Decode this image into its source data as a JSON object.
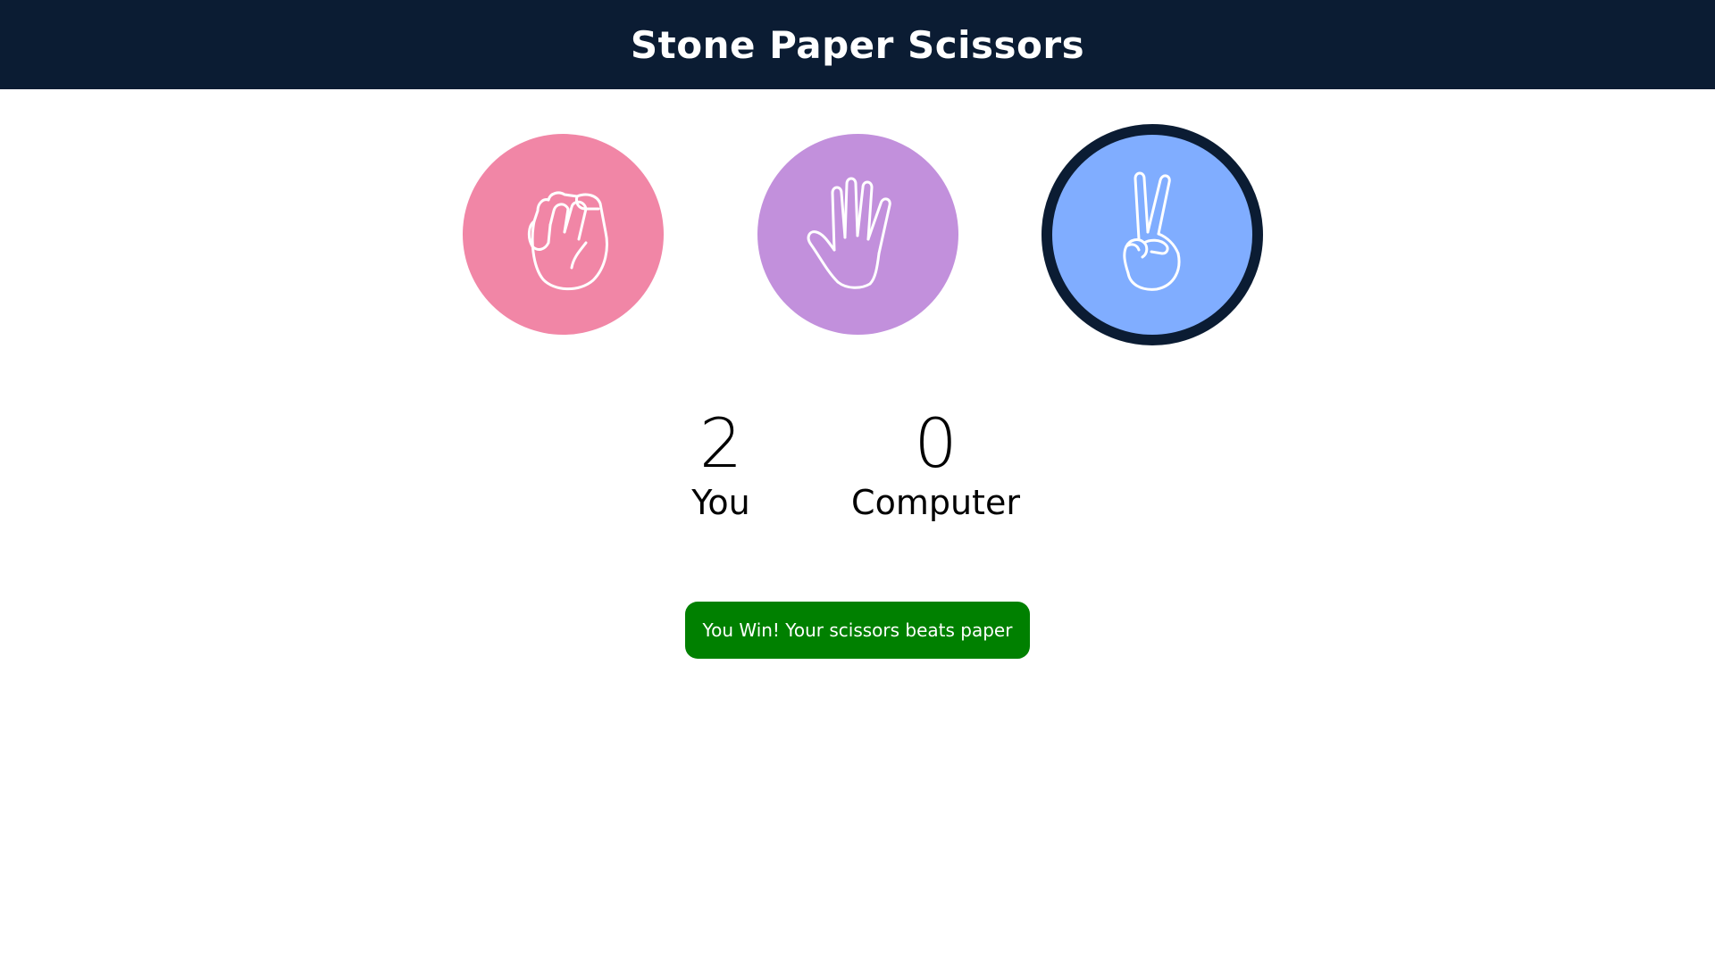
{
  "header": {
    "title": "Stone Paper Scissors"
  },
  "choices": [
    {
      "name": "stone",
      "icon": "fist-icon",
      "color": "#f186a6",
      "selected": false
    },
    {
      "name": "paper",
      "icon": "open-hand-icon",
      "color": "#c290dc",
      "selected": false
    },
    {
      "name": "scissors",
      "icon": "victory-hand-icon",
      "color": "#80adff",
      "selected": true
    }
  ],
  "scoreboard": {
    "user": {
      "score": "2",
      "label": "You"
    },
    "computer": {
      "score": "0",
      "label": "Computer"
    }
  },
  "result": {
    "message": "You Win! Your scissors beats paper",
    "color": "#008000"
  },
  "colors": {
    "header_bg": "#0b1c33",
    "selected_border": "#0b1c33"
  }
}
